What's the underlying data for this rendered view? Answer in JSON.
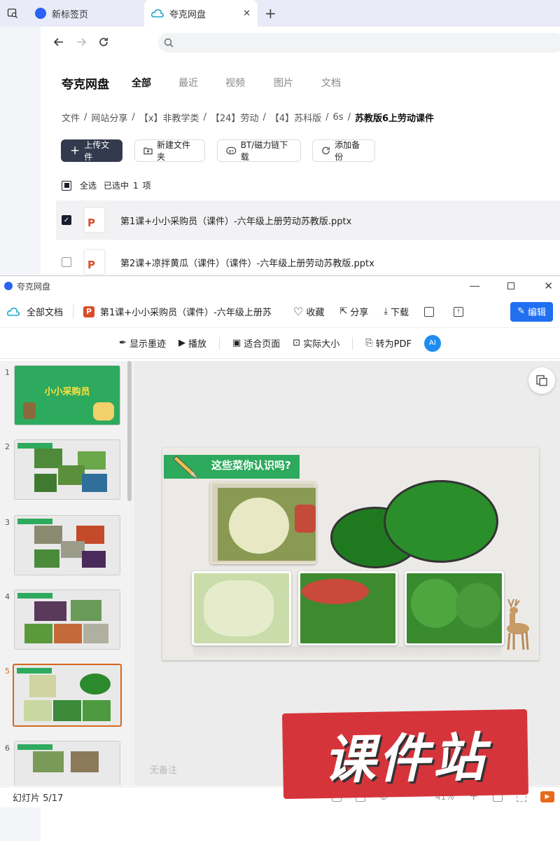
{
  "browser": {
    "tabs": [
      {
        "label": "新标签页",
        "icon": "browser-logo-icon"
      },
      {
        "label": "夸克网盘",
        "icon": "cloud-icon"
      }
    ],
    "new_tab": "+",
    "close": "✕"
  },
  "cloud": {
    "brand": "夸克网盘",
    "nav": [
      "全部",
      "最近",
      "视频",
      "图片",
      "文档"
    ],
    "breadcrumb": [
      "文件",
      "网站分享",
      "【x】非教学类",
      "【24】劳动",
      "【4】苏科版",
      "6s",
      "苏教版6上劳动课件"
    ],
    "buttons": {
      "upload": "上传文件",
      "new_folder": "新建文件夹",
      "bt": "BT/磁力链下载",
      "backup": "添加备份"
    },
    "select_all": "全选",
    "selected": "已选中",
    "selected_count": "1",
    "selected_unit": "项",
    "files": [
      {
        "name": "第1课+小小采购员（课件）-六年级上册劳动苏教版.pptx",
        "checked": true
      },
      {
        "name": "第2课+凉拌黄瓜（课件）（课件）-六年级上册劳动苏教版.pptx",
        "checked": false
      }
    ]
  },
  "viewer": {
    "window_title": "夸克网盘",
    "all_docs": "全部文档",
    "doc_title": "第1课+小小采购员（课件）-六年级上册苏",
    "actions": {
      "favorite": "收藏",
      "share": "分享",
      "download": "下载",
      "edit": "编辑"
    },
    "tools": {
      "ink": "显示墨迹",
      "play": "播放",
      "fit": "适合页面",
      "actual": "实际大小",
      "pdf": "转为PDF",
      "ai": "AI"
    },
    "thumb_numbers": [
      "1",
      "2",
      "3",
      "4",
      "5",
      "6"
    ],
    "thumb1_title": "小小采购员",
    "slide_title": "这些菜你认识吗?",
    "notes": "无备注",
    "status": "幻灯片 5/17",
    "zoom": "41%",
    "watermark": "课件站"
  }
}
